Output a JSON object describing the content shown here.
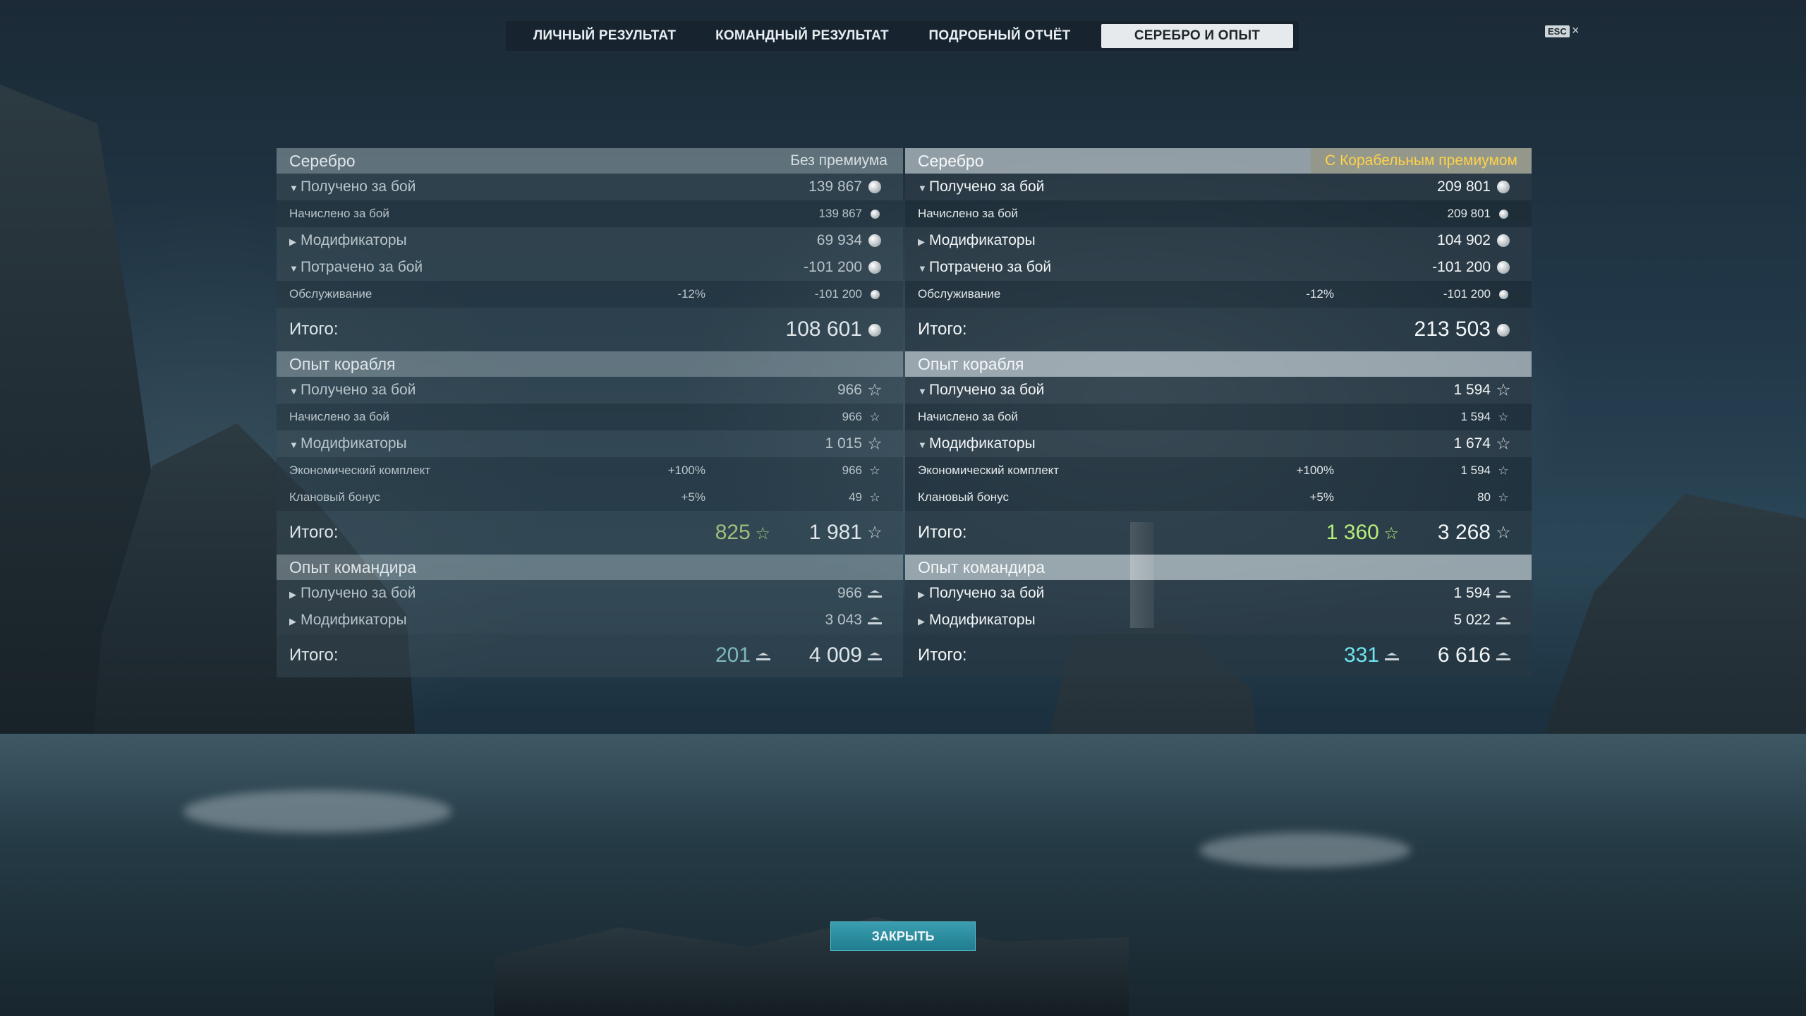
{
  "tabs": [
    {
      "label": "ЛИЧНЫЙ РЕЗУЛЬТАТ"
    },
    {
      "label": "КОМАНДНЫЙ РЕЗУЛЬТАТ"
    },
    {
      "label": "ПОДРОБНЫЙ ОТЧЁТ"
    },
    {
      "label": "СЕРЕБРО И ОПЫТ",
      "active": true
    }
  ],
  "esc_label": "ESC",
  "close_glyph": "×",
  "close_button": "ЗАКРЫТЬ",
  "colors": {
    "premium_note": "#ffd24a",
    "close_button": "#2a8ea0"
  },
  "left": {
    "silver": {
      "title": "Серебро",
      "note": "Без премиума",
      "received": {
        "label": "Получено за бой",
        "value": "139 867"
      },
      "accrued": {
        "label": "Начислено за бой",
        "value": "139 867"
      },
      "modifiers": {
        "label": "Модификаторы",
        "value": "69 934"
      },
      "spent": {
        "label": "Потрачено за бой",
        "value": "-101 200"
      },
      "service": {
        "label": "Обслуживание",
        "pct": "-12%",
        "value": "-101 200"
      },
      "total": {
        "label": "Итого:",
        "value": "108 601"
      }
    },
    "ship_xp": {
      "title": "Опыт корабля",
      "received": {
        "label": "Получено за бой",
        "value": "966"
      },
      "accrued": {
        "label": "Начислено за бой",
        "value": "966"
      },
      "modifiers": {
        "label": "Модификаторы",
        "value": "1 015"
      },
      "eco": {
        "label": "Экономический комплект",
        "pct": "+100%",
        "value": "966"
      },
      "clan": {
        "label": "Клановый бонус",
        "pct": "+5%",
        "value": "49"
      },
      "total": {
        "label": "Итого:",
        "free": "825",
        "value": "1 981"
      }
    },
    "cmdr_xp": {
      "title": "Опыт командира",
      "received": {
        "label": "Получено за бой",
        "value": "966"
      },
      "modifiers": {
        "label": "Модификаторы",
        "value": "3 043"
      },
      "total": {
        "label": "Итого:",
        "elite": "201",
        "value": "4 009"
      }
    }
  },
  "right": {
    "silver": {
      "title": "Серебро",
      "note": "С Корабельным премиумом",
      "received": {
        "label": "Получено за бой",
        "value": "209 801"
      },
      "accrued": {
        "label": "Начислено за бой",
        "value": "209 801"
      },
      "modifiers": {
        "label": "Модификаторы",
        "value": "104 902"
      },
      "spent": {
        "label": "Потрачено за бой",
        "value": "-101 200"
      },
      "service": {
        "label": "Обслуживание",
        "pct": "-12%",
        "value": "-101 200"
      },
      "total": {
        "label": "Итого:",
        "value": "213 503"
      }
    },
    "ship_xp": {
      "title": "Опыт корабля",
      "received": {
        "label": "Получено за бой",
        "value": "1 594"
      },
      "accrued": {
        "label": "Начислено за бой",
        "value": "1 594"
      },
      "modifiers": {
        "label": "Модификаторы",
        "value": "1 674"
      },
      "eco": {
        "label": "Экономический комплект",
        "pct": "+100%",
        "value": "1 594"
      },
      "clan": {
        "label": "Клановый бонус",
        "pct": "+5%",
        "value": "80"
      },
      "total": {
        "label": "Итого:",
        "free": "1 360",
        "value": "3 268"
      }
    },
    "cmdr_xp": {
      "title": "Опыт командира",
      "received": {
        "label": "Получено за бой",
        "value": "1 594"
      },
      "modifiers": {
        "label": "Модификаторы",
        "value": "5 022"
      },
      "total": {
        "label": "Итого:",
        "elite": "331",
        "value": "6 616"
      }
    }
  }
}
